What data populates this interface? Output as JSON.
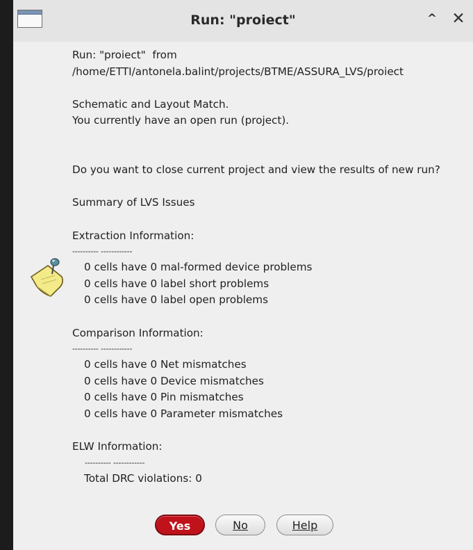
{
  "window": {
    "title": "Run: \"proiect\"",
    "controls": {
      "maximize": "^",
      "close": "✕"
    }
  },
  "message": {
    "line1": "Run: \"proiect\"  from",
    "line2": "/home/ETTI/antonela.balint/projects/BTME/ASSURA_LVS/proiect",
    "line3": "Schematic and Layout Match.",
    "line4": "You currently have an open run (project).",
    "line5": "Do you want to close current project and view the results of new run?",
    "summary": "Summary of LVS Issues",
    "extraction": {
      "heading": "Extraction Information:",
      "divider": "---------- ------------",
      "items": [
        "0 cells have 0 mal-formed device problems",
        "0 cells have 0 label short problems",
        "0 cells have 0 label open problems"
      ]
    },
    "comparison": {
      "heading": "Comparison Information:",
      "divider": "---------- ------------",
      "items": [
        "0 cells have 0 Net mismatches",
        "0 cells have 0 Device mismatches",
        "0 cells have 0 Pin mismatches",
        "0 cells have 0 Parameter mismatches"
      ]
    },
    "elw": {
      "heading": "ELW Information:",
      "divider": "---------- ------------",
      "items": [
        "Total DRC violations: 0"
      ]
    }
  },
  "buttons": {
    "yes": "Yes",
    "no": "No",
    "help": "Help"
  },
  "colors": {
    "yes_button": "#c0121b",
    "dialog_bg": "#efefef",
    "note_icon": "#f3ea8a"
  },
  "icons": {
    "dialog_icon": "note-pushpin-icon"
  }
}
